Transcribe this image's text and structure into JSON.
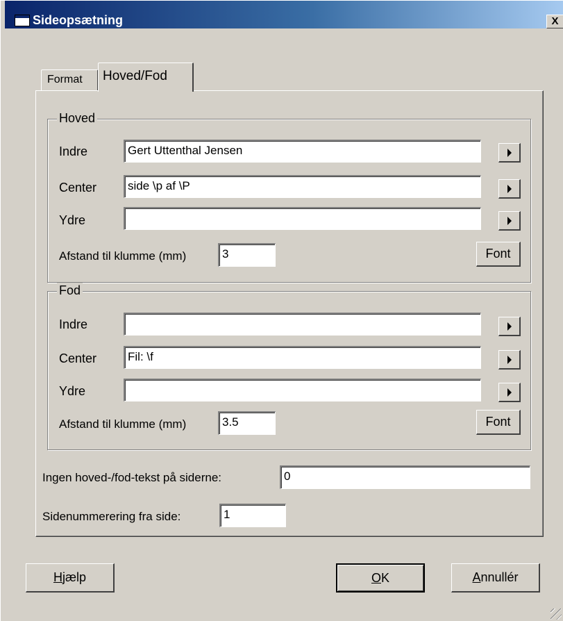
{
  "window": {
    "title": "Sideopsætning",
    "close_label": "X"
  },
  "tabs": [
    {
      "label": "Format"
    },
    {
      "label": "Hoved/Fod"
    }
  ],
  "header_group": {
    "legend": "Hoved",
    "rows": [
      {
        "label": "Indre",
        "value": "Gert Uttenthal Jensen"
      },
      {
        "label": "Center",
        "value": "side \\p af \\P"
      },
      {
        "label": "Ydre",
        "value": ""
      }
    ],
    "distance_label": "Afstand til klumme (mm)",
    "distance_value": "3",
    "font_button": "Font"
  },
  "footer_group": {
    "legend": "Fod",
    "rows": [
      {
        "label": "Indre",
        "value": ""
      },
      {
        "label": "Center",
        "value": "Fil: \\f"
      },
      {
        "label": "Ydre",
        "value": ""
      }
    ],
    "distance_label": "Afstand til klumme (mm)",
    "distance_value": "3.5",
    "font_button": "Font"
  },
  "no_header_pages": {
    "label": "Ingen hoved-/fod-tekst på siderne:",
    "value": "0"
  },
  "page_numbering": {
    "label": "Sidenummerering fra side:",
    "value": "1"
  },
  "buttons": {
    "help_prefix": "H",
    "help_rest": "jælp",
    "ok_prefix": "O",
    "ok_rest": "K",
    "cancel_prefix": "A",
    "cancel_rest": "nnullér"
  }
}
